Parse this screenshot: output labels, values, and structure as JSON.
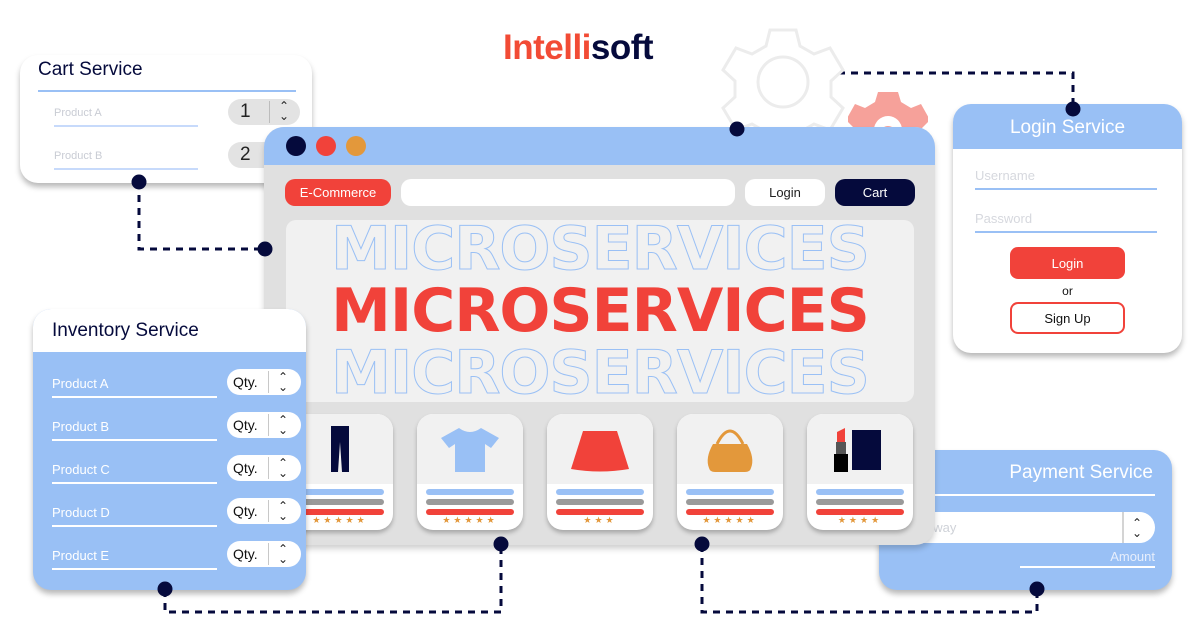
{
  "brand": {
    "part1": "Intelli",
    "part2": "soft"
  },
  "colors": {
    "accent_red": "#f1423a",
    "navy": "#050a3c",
    "light_blue": "#99c0f5",
    "orange": "#e3983b",
    "panel_grey": "#e0e0e0"
  },
  "cart_service": {
    "title": "Cart Service",
    "items": [
      {
        "label": "Product A",
        "qty": "1"
      },
      {
        "label": "Product B",
        "qty": "2"
      }
    ]
  },
  "browser": {
    "window_dots": [
      "navy",
      "red",
      "orange"
    ],
    "nav": {
      "brand_button": "E-Commerce",
      "search_value": "",
      "login_button": "Login",
      "cart_button": "Cart"
    },
    "hero": {
      "outline_top": "MICROSERVICES",
      "main": "MICROSERVICES",
      "outline_bottom": "MICROSERVICES"
    },
    "products": [
      {
        "icon": "pants-icon",
        "rating": 5
      },
      {
        "icon": "tshirt-icon",
        "rating": 5
      },
      {
        "icon": "skirt-icon",
        "rating": 3
      },
      {
        "icon": "handbag-icon",
        "rating": 5
      },
      {
        "icon": "cosmetics-icon",
        "rating": 4
      }
    ]
  },
  "login_service": {
    "title": "Login Service",
    "username_placeholder": "Username",
    "password_placeholder": "Password",
    "login_button": "Login",
    "or_text": "or",
    "signup_button": "Sign Up"
  },
  "inventory_service": {
    "title": "Inventory Service",
    "qty_label": "Qty.",
    "items": [
      {
        "label": "Product A"
      },
      {
        "label": "Product B"
      },
      {
        "label": "Product C"
      },
      {
        "label": "Product D"
      },
      {
        "label": "Product E"
      }
    ]
  },
  "payment_service": {
    "title": "Payment Service",
    "gateway_placeholder": "eway",
    "amount_label": "Amount"
  },
  "stars": {
    "r5": "★★★★★",
    "r4": "★★★★",
    "r3": "★★★"
  }
}
